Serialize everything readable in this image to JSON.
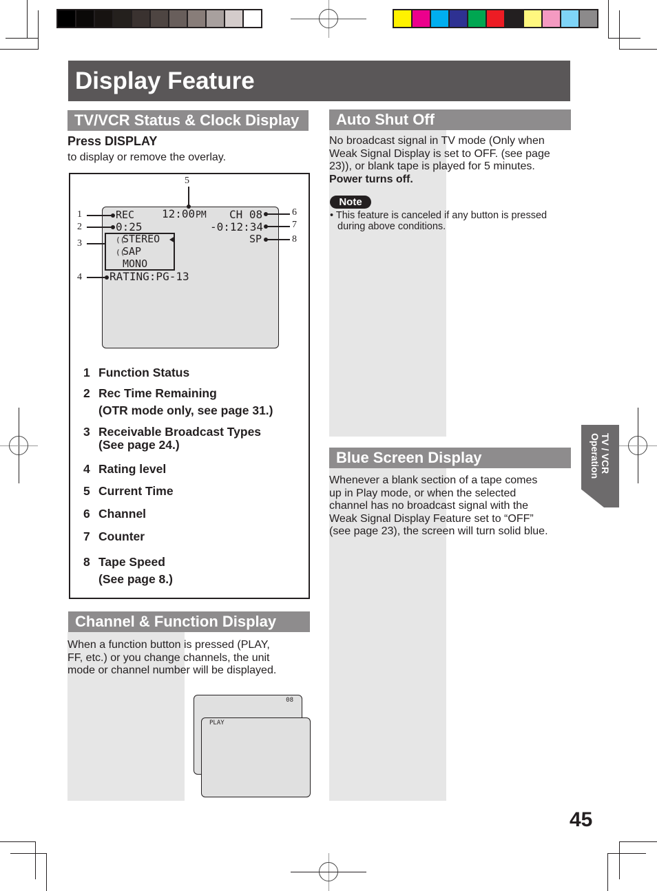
{
  "page": {
    "title": "Display Feature",
    "page_number": "45",
    "side_tab": [
      "TV / VCR",
      "Operation"
    ]
  },
  "color_bars": {
    "grayscale": [
      "#000000",
      "#0b0908",
      "#171311",
      "#24201d",
      "#3a3230",
      "#4e4542",
      "#685e5b",
      "#887d79",
      "#a8a09e",
      "#d4cccb",
      "#ffffff"
    ],
    "process": [
      "#fff200",
      "#ec008c",
      "#00aeef",
      "#2e3192",
      "#00a651",
      "#ed1c24",
      "#231f20",
      "#fff77f",
      "#f49ac1",
      "#7fd4f7",
      "#8c8a8b"
    ]
  },
  "status_section": {
    "heading": "TV/VCR Status & Clock Display",
    "instruction_bold": "Press DISPLAY",
    "instruction": "to display or remove the overlay.",
    "osd": {
      "rec": "REC",
      "time": "12:00",
      "ampm": "PM",
      "channel": "CH 08",
      "rec_time": "0:25",
      "counter": "-0:12:34",
      "stereo": "STEREO",
      "sap": "SAP",
      "mono": "MONO",
      "speed": "SP",
      "rating": "RATING:PG-13"
    },
    "callouts": [
      "1",
      "2",
      "3",
      "4",
      "5",
      "6",
      "7",
      "8"
    ],
    "legend": [
      {
        "num": "1",
        "text": "Function Status"
      },
      {
        "num": "2",
        "text": "Rec Time Remaining",
        "sub": "(OTR mode only, see page 31.)"
      },
      {
        "num": "3",
        "text": "Receivable Broadcast Types",
        "sub": "(See page 24.)"
      },
      {
        "num": "4",
        "text": "Rating level"
      },
      {
        "num": "5",
        "text": "Current Time"
      },
      {
        "num": "6",
        "text": "Channel"
      },
      {
        "num": "7",
        "text": "Counter"
      },
      {
        "num": "8",
        "text": "Tape Speed",
        "sub": "(See page 8.)"
      }
    ]
  },
  "channel_section": {
    "heading": "Channel & Function Display",
    "body": [
      "When a function button is pressed (PLAY,",
      "FF, etc.) or you change channels, the unit",
      "mode or channel number will be displayed."
    ],
    "screen_back_text": "08",
    "screen_front_text": "PLAY"
  },
  "auto_shut_off": {
    "heading": "Auto Shut Off",
    "body": [
      "No broadcast signal in TV mode (Only when",
      "Weak Signal Display is set to OFF. (see page",
      "23)), or blank tape is played for 5 minutes."
    ],
    "bold": "Power turns off.",
    "note_label": "Note",
    "note": [
      "This feature is canceled if any button is pressed",
      "during above conditions."
    ]
  },
  "blue_screen": {
    "heading": "Blue Screen Display",
    "body": [
      "Whenever a blank section of a tape comes",
      "up in Play mode, or when the selected",
      "channel has no broadcast signal with the",
      "Weak Signal Display Feature set to “OFF”",
      "(see page 23), the screen will turn solid blue."
    ]
  }
}
